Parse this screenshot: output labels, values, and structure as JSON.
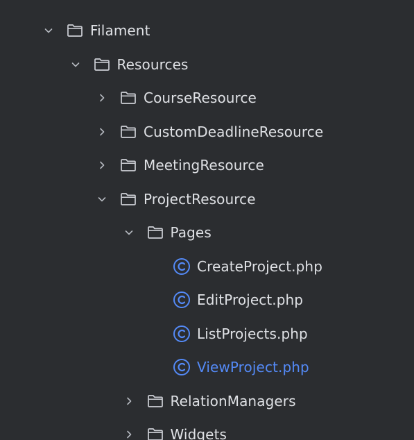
{
  "colors": {
    "background": "#2b2d30",
    "text": "#dfe1e5",
    "folder_icon": "#ced0d6",
    "class_icon": "#548af7",
    "active_text": "#548af7"
  },
  "tree": [
    {
      "key": "filament",
      "label": "Filament",
      "depth": 0,
      "state": "expanded",
      "icon": "folder-icon"
    },
    {
      "key": "resources",
      "label": "Resources",
      "depth": 1,
      "state": "expanded",
      "icon": "folder-icon"
    },
    {
      "key": "courseresource",
      "label": "CourseResource",
      "depth": 2,
      "state": "collapsed",
      "icon": "folder-icon"
    },
    {
      "key": "customdeadlineresource",
      "label": "CustomDeadlineResource",
      "depth": 2,
      "state": "collapsed",
      "icon": "folder-icon"
    },
    {
      "key": "meetingresource",
      "label": "MeetingResource",
      "depth": 2,
      "state": "collapsed",
      "icon": "folder-icon"
    },
    {
      "key": "projectresource",
      "label": "ProjectResource",
      "depth": 2,
      "state": "expanded",
      "icon": "folder-icon"
    },
    {
      "key": "pages",
      "label": "Pages",
      "depth": 3,
      "state": "expanded",
      "icon": "folder-icon"
    },
    {
      "key": "createproject",
      "label": "CreateProject.php",
      "depth": 4,
      "state": "leaf",
      "icon": "php-class-icon"
    },
    {
      "key": "editproject",
      "label": "EditProject.php",
      "depth": 4,
      "state": "leaf",
      "icon": "php-class-icon"
    },
    {
      "key": "listprojects",
      "label": "ListProjects.php",
      "depth": 4,
      "state": "leaf",
      "icon": "php-class-icon"
    },
    {
      "key": "viewproject",
      "label": "ViewProject.php",
      "depth": 4,
      "state": "leaf",
      "icon": "php-class-icon",
      "active": true
    },
    {
      "key": "relationmanagers",
      "label": "RelationManagers",
      "depth": 3,
      "state": "collapsed",
      "icon": "folder-icon"
    },
    {
      "key": "widgets",
      "label": "Widgets",
      "depth": 3,
      "state": "collapsed",
      "icon": "folder-icon"
    }
  ]
}
